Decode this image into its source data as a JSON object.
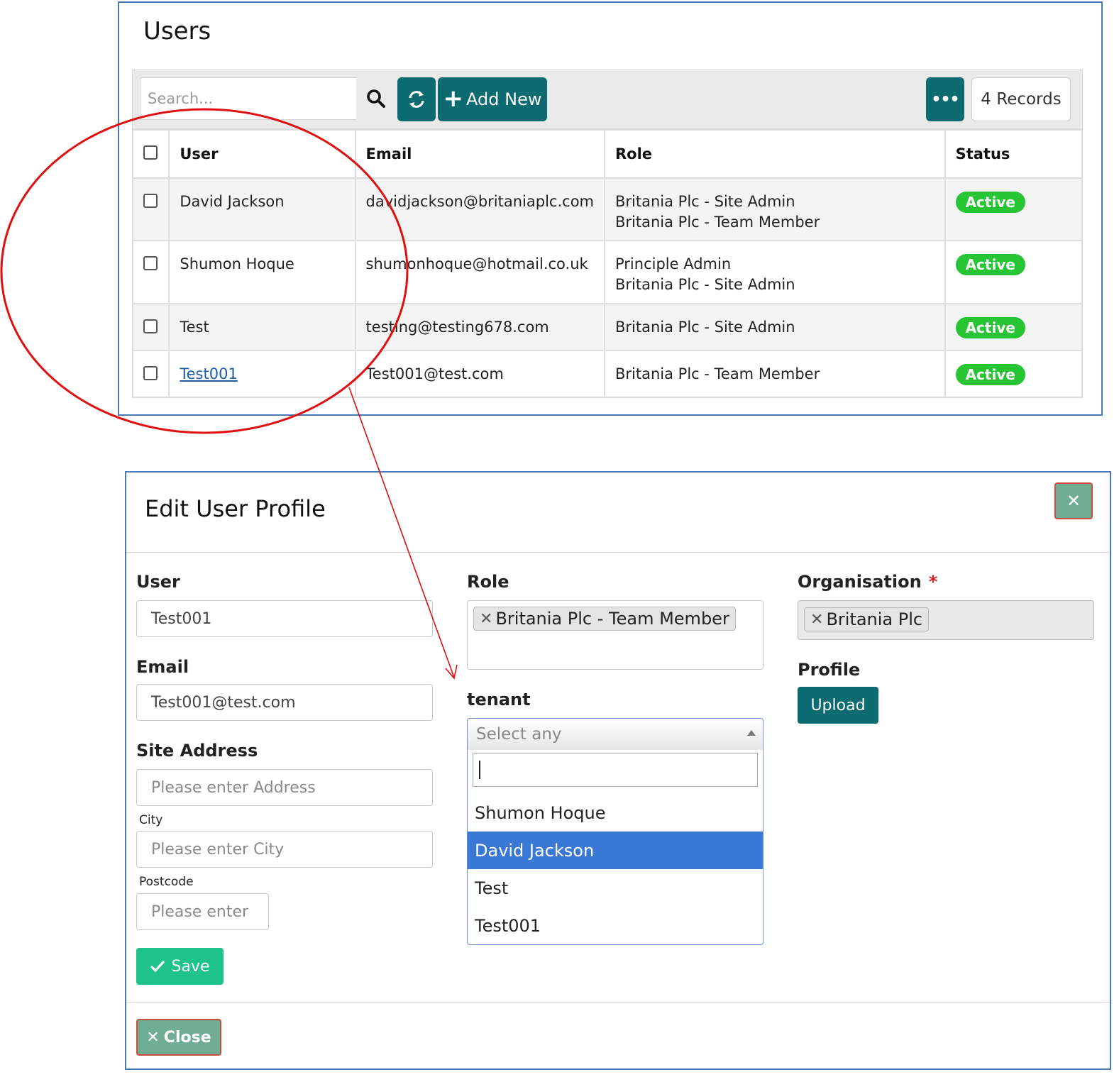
{
  "users": {
    "title": "Users",
    "search_placeholder": "Search...",
    "add_new_label": "Add New",
    "records_label": "4 Records",
    "columns": [
      "User",
      "Email",
      "Role",
      "Status"
    ],
    "rows": [
      {
        "user": "David Jackson",
        "email": "davidjackson@britaniaplc.com",
        "role_1": "Britania Plc - Site Admin",
        "role_2": "Britania Plc - Team Member",
        "status": "Active"
      },
      {
        "user": "Shumon Hoque",
        "email": "shumonhoque@hotmail.co.uk",
        "role_1": "Principle Admin",
        "role_2": "Britania Plc - Site Admin",
        "status": "Active"
      },
      {
        "user": "Test",
        "email": "testing@testing678.com",
        "role_1": "Britania Plc - Site Admin",
        "role_2": "",
        "status": "Active"
      },
      {
        "user": "Test001",
        "email": "Test001@test.com",
        "role_1": "Britania Plc - Team Member",
        "role_2": "",
        "status": "Active"
      }
    ]
  },
  "modal": {
    "title": "Edit User Profile",
    "user_label": "User",
    "user_value": "Test001",
    "email_label": "Email",
    "email_value": "Test001@test.com",
    "site_address_label": "Site Address",
    "address_placeholder": "Please enter Address",
    "city_label": "City",
    "city_placeholder": "Please enter City",
    "postcode_label": "Postcode",
    "postcode_placeholder": "Please enter P",
    "save_label": "Save",
    "close_label": "Close",
    "role_label": "Role",
    "role_tags": [
      "Britania Plc - Team Member"
    ],
    "tenant_label": "tenant",
    "tenant_placeholder": "Select any",
    "tenant_options": [
      "Shumon Hoque",
      "David Jackson",
      "Test",
      "Test001"
    ],
    "tenant_highlighted": "David Jackson",
    "organisation_label": "Organisation",
    "required_mark": "*",
    "organisation_tags": [
      "Britania Plc"
    ],
    "profile_label": "Profile",
    "upload_label": "Upload"
  },
  "colors": {
    "teal": "#0b6b70",
    "active_green": "#27c533",
    "save_green": "#1ec28b",
    "highlight_blue": "#3a78d6",
    "annotation_red": "#e01010"
  }
}
